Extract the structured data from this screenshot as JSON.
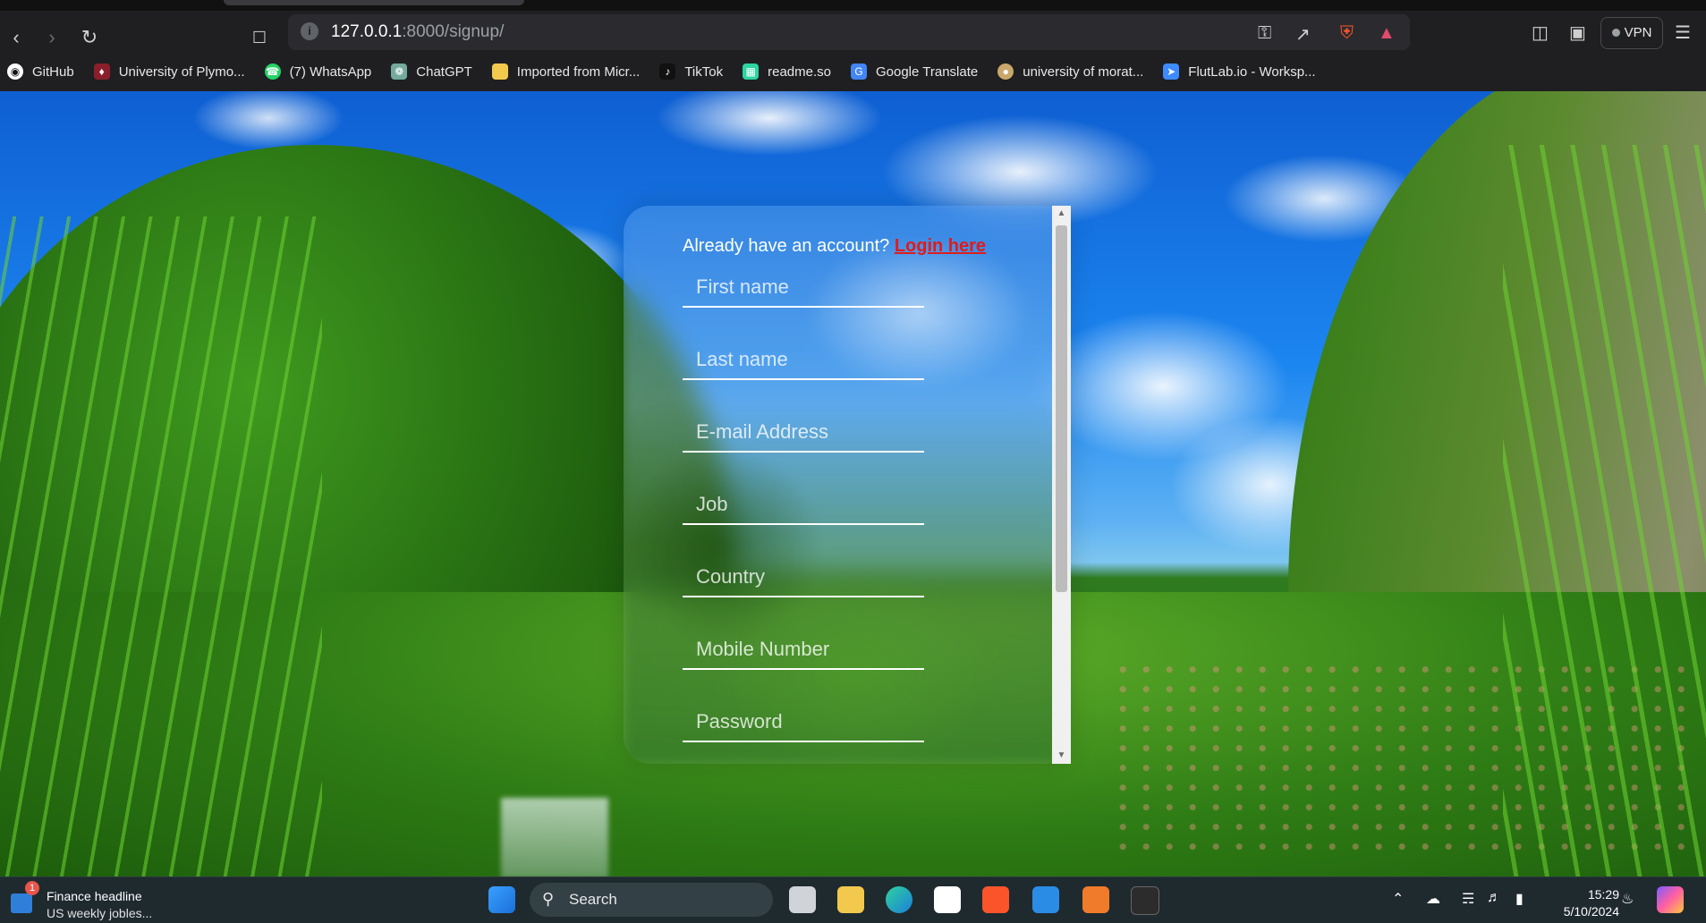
{
  "browser": {
    "url_host": "127.0.0.1",
    "url_path": ":8000/signup/",
    "vpn_label": "VPN",
    "bookmarks": [
      {
        "label": "GitHub",
        "icon": "github-icon",
        "color": "#ffffff"
      },
      {
        "label": "University of Plymo...",
        "icon": "university-crest-icon",
        "color": "#8a1f2b"
      },
      {
        "label": "(7) WhatsApp",
        "icon": "whatsapp-icon",
        "color": "#25d366"
      },
      {
        "label": "ChatGPT",
        "icon": "chatgpt-icon",
        "color": "#74aa9c"
      },
      {
        "label": "Imported from Micr...",
        "icon": "folder-icon",
        "color": "#f2c94c"
      },
      {
        "label": "TikTok",
        "icon": "tiktok-icon",
        "color": "#111111"
      },
      {
        "label": "readme.so",
        "icon": "readme-icon",
        "color": "#2dd4a0"
      },
      {
        "label": "Google Translate",
        "icon": "google-translate-icon",
        "color": "#4285f4"
      },
      {
        "label": "university of morat...",
        "icon": "university-moratuwa-icon",
        "color": "#caa76a"
      },
      {
        "label": "FlutLab.io - Worksp...",
        "icon": "flutlab-icon",
        "color": "#3d8bfd"
      }
    ]
  },
  "signup": {
    "already_text": "Already have an account? ",
    "login_link": "Login here",
    "fields": {
      "first_name": "First name",
      "last_name": "Last name",
      "email": "E-mail Address",
      "job": "Job",
      "country": "Country",
      "mobile": "Mobile Number",
      "password": "Password"
    }
  },
  "taskbar": {
    "news_badge": "1",
    "news_title": "Finance headline",
    "news_sub": "US weekly jobles...",
    "search_label": "Search",
    "time": "15:29",
    "date": "5/10/2024"
  },
  "colors": {
    "login_link": "#e01b1b",
    "field_border": "#ffffff"
  }
}
